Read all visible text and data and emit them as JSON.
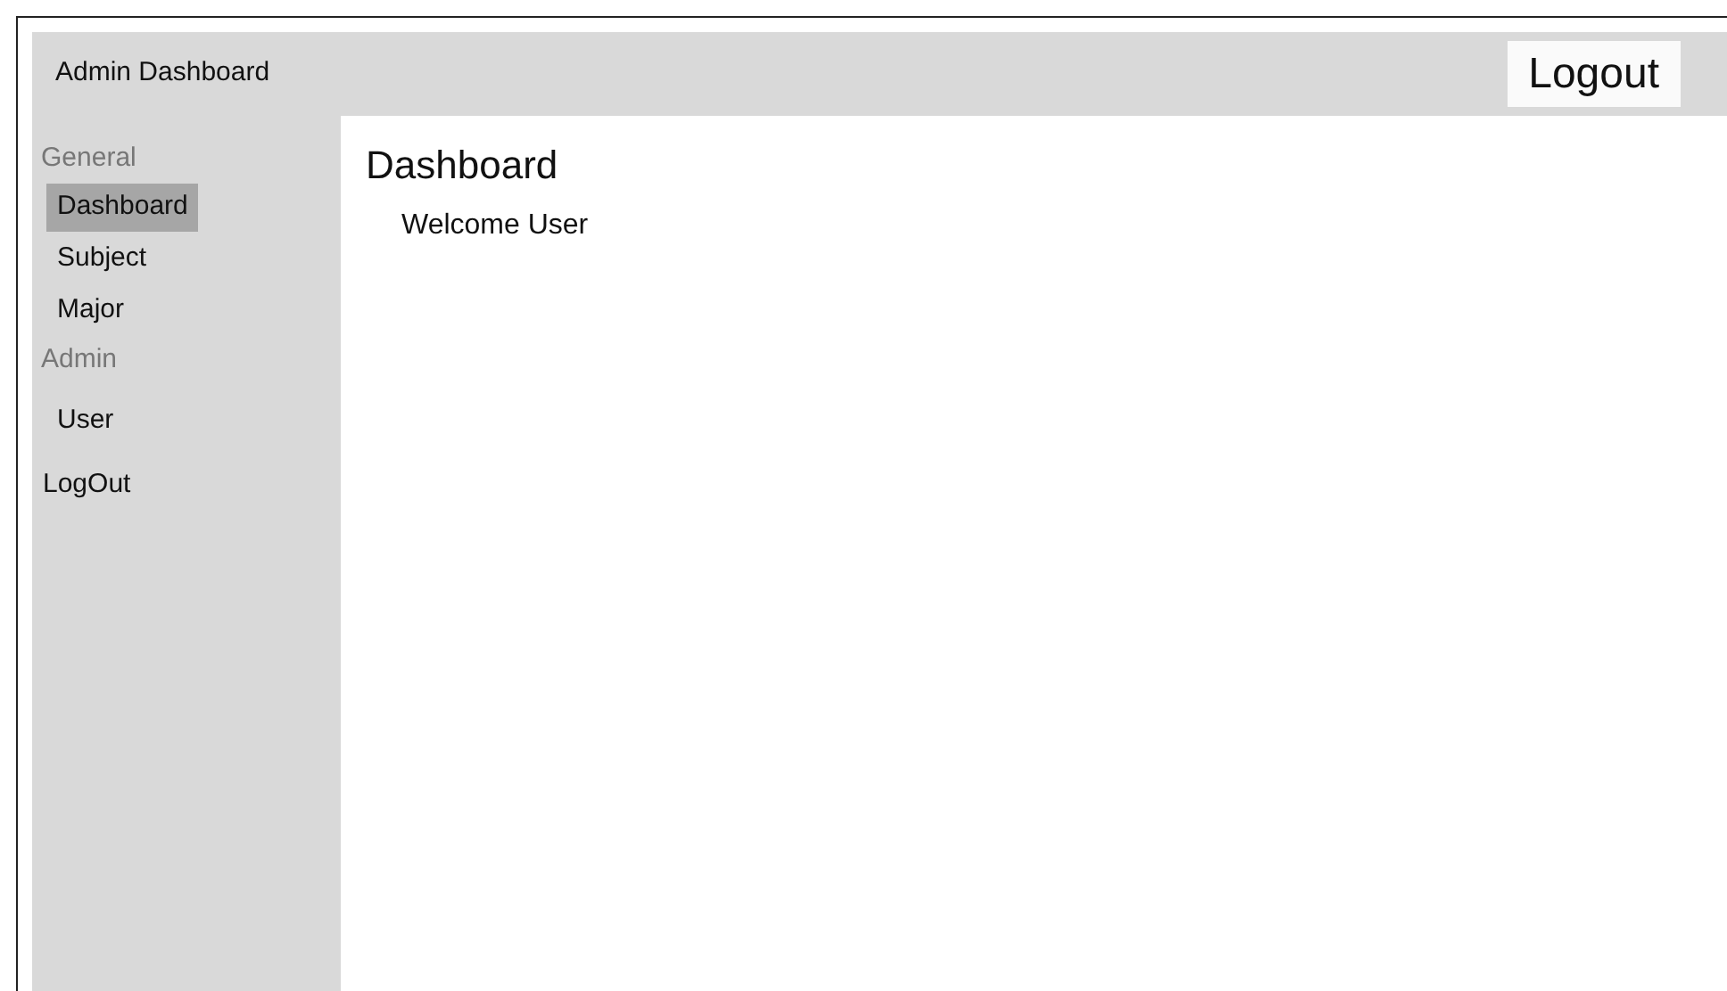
{
  "header": {
    "title": "Admin Dashboard",
    "logout_button": "Logout"
  },
  "sidebar": {
    "sections": [
      {
        "heading": "General",
        "items": [
          {
            "label": "Dashboard",
            "selected": true
          },
          {
            "label": "Subject",
            "selected": false
          },
          {
            "label": "Major",
            "selected": false
          }
        ]
      },
      {
        "heading": "Admin",
        "items": [
          {
            "label": "User",
            "selected": false
          }
        ]
      }
    ],
    "logout_link": "LogOut"
  },
  "main": {
    "title": "Dashboard",
    "welcome": "Welcome User"
  }
}
